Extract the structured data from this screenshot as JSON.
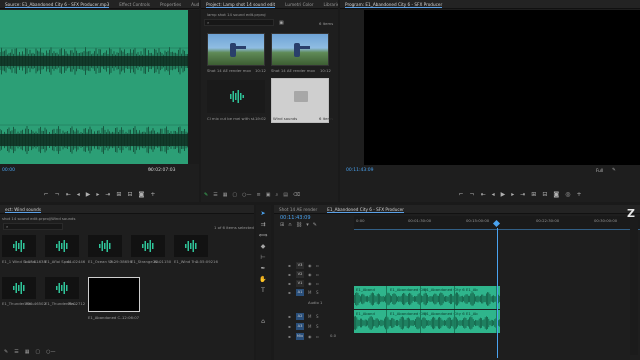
{
  "source_monitor": {
    "tabs": [
      "Source: E1_Abandoned City 6 - SFX Producer.mp3",
      "Effect Controls",
      "Properties",
      "Audio Clip Mixer: E1_"
    ],
    "timecode_left": "00:00",
    "timecode_right": "00:02:07:03",
    "wave_color": "#2c9f76"
  },
  "project": {
    "tabs": [
      "Project: Lamp shot 14 sound edit",
      "Lumetri Color",
      "Libraries"
    ],
    "filename": "lamp shot 14 sound edit.prproj",
    "item_count": "6 items",
    "items": [
      {
        "label": "Shot 14 AE render mov",
        "duration": "10:12"
      },
      {
        "label": "Shot 14 AE render mov",
        "duration": "10:12"
      },
      {
        "label": "Cl mix cut be mei with st...",
        "duration": "19:02"
      },
      {
        "label": "Wind sounds",
        "duration": "6 items"
      }
    ]
  },
  "program_monitor": {
    "title": "Program: E1_Abandoned City 6 - SFX Producer",
    "timecode_left": "00:11:43:09",
    "fit_label": "Fit",
    "full_label": "Full",
    "timecode_right": "00:12:41:04"
  },
  "bin": {
    "path": "ect: Wind sounds",
    "subpath": "shot 14 sound edit.prproj\\Wind sounds",
    "selection": "1 of 6 items selected",
    "items": [
      {
        "label": "E1_1 Wind Sound...",
        "duration": "1:07:01638"
      },
      {
        "label": "E1_Afloi Spec...",
        "duration": "41:02446"
      },
      {
        "label": "E1_Ocean Wi...",
        "duration": "2:29:38656"
      },
      {
        "label": "E1_Strange W...",
        "duration": "20:01150"
      },
      {
        "label": "E1_Wind Tru...",
        "duration": "2:55:09216"
      },
      {
        "label": "E1_Thunder Ra...",
        "duration": "1:59:46502"
      },
      {
        "label": "E1_Thunder Ra...",
        "duration": "49:02712"
      },
      {
        "label": "E1_Abandoned C...",
        "duration": "12:06:07"
      }
    ]
  },
  "timeline": {
    "tabs": [
      "Shot 14 AE render",
      "E1_Abandoned City 6 - SFX Producer"
    ],
    "timecode": "00:11:43:09",
    "ruler": [
      "0:00",
      "00:01:30:00",
      "00:15:00:00",
      "00:22:30:00",
      "00:30:00:00"
    ],
    "track_labels": [
      "V3",
      "V2",
      "V1",
      "A1",
      "A2",
      "A3",
      "Mix"
    ],
    "track_name": "Audio 1",
    "mix_value": "0.0",
    "clip_names": [
      "E1_Aband",
      "E1_Abandoned City",
      "E1_Abandoned City 6",
      "E1_Ab",
      "E1_Aband",
      "E1_Abandoned City",
      "E1_Abandoned City 6",
      "E1_Ab"
    ],
    "clip_color": "#2fb58c"
  },
  "overlay_glyph": "Z"
}
